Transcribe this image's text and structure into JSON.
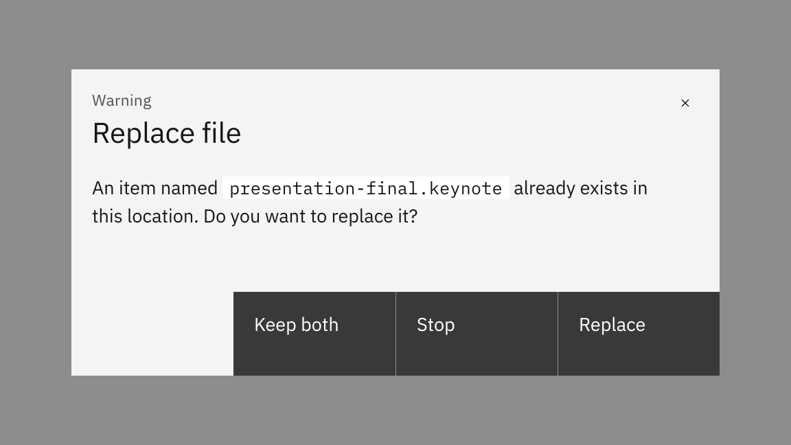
{
  "modal": {
    "label": "Warning",
    "title": "Replace file",
    "body_prefix": "An item named ",
    "filename": "presentation-final.keynote",
    "body_suffix": " already exists in this location. Do you want to replace it?",
    "buttons": {
      "keep_both": "Keep both",
      "stop": "Stop",
      "replace": "Replace"
    }
  }
}
